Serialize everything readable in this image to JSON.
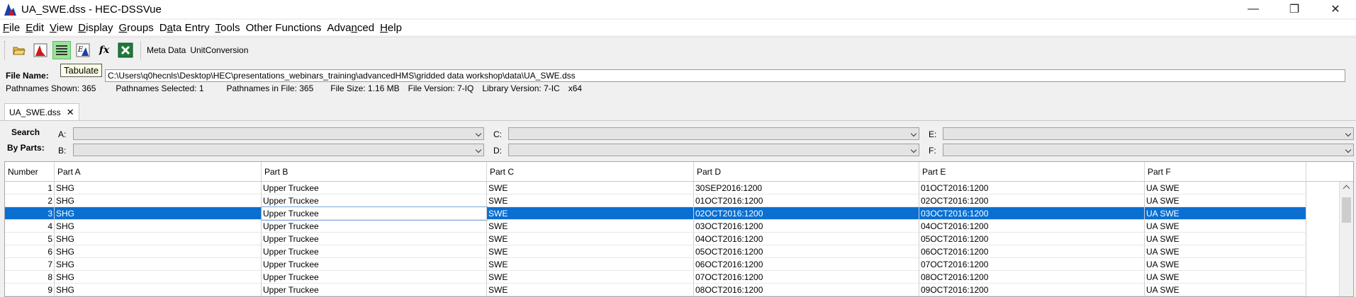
{
  "window": {
    "title": "UA_SWE.dss - HEC-DSSVue",
    "minimize": "—",
    "maximize": "❐",
    "close": "✕"
  },
  "menu": [
    {
      "pre": "",
      "u": "F",
      "post": "ile"
    },
    {
      "pre": "",
      "u": "E",
      "post": "dit"
    },
    {
      "pre": "",
      "u": "V",
      "post": "iew"
    },
    {
      "pre": "",
      "u": "D",
      "post": "isplay"
    },
    {
      "pre": "",
      "u": "G",
      "post": "roups"
    },
    {
      "pre": "D",
      "u": "a",
      "post": "ta Entry"
    },
    {
      "pre": "",
      "u": "T",
      "post": "ools"
    },
    {
      "pre": "Other Functions",
      "u": "",
      "post": ""
    },
    {
      "pre": "Adva",
      "u": "n",
      "post": "ced"
    },
    {
      "pre": "",
      "u": "H",
      "post": "elp"
    }
  ],
  "toolbar": {
    "metadata_label": "Meta Data",
    "unitconversion_label": "UnitConversion",
    "tooltip": "Tabulate",
    "fx_label": "fx"
  },
  "file": {
    "label": "File Name:",
    "path": "C:\\Users\\q0hecnls\\Desktop\\HEC\\presentations_webinars_training\\advancedHMS\\gridded data workshop\\data\\UA_SWE.dss"
  },
  "stats": {
    "shown": "Pathnames Shown:  365",
    "selected": "Pathnames Selected: 1",
    "in_file": "Pathnames in File:  365",
    "size": "File Size:  1.16  MB",
    "version": "File Version: 7-IQ",
    "library": "Library Version: 7-IC",
    "arch": "x64"
  },
  "tab": {
    "label": "UA_SWE.dss",
    "close": "✕"
  },
  "search": {
    "label1": "Search",
    "label2": "By Parts:",
    "parts": [
      "A:",
      "B:",
      "C:",
      "D:",
      "E:",
      "F:"
    ]
  },
  "table": {
    "headers": [
      "Number",
      "Part A",
      "Part B",
      "Part C",
      "Part D",
      "Part E",
      "Part F"
    ],
    "selected_row": 2,
    "rows": [
      [
        "1",
        "SHG",
        "Upper Truckee",
        "SWE",
        "30SEP2016:1200",
        "01OCT2016:1200",
        "UA SWE"
      ],
      [
        "2",
        "SHG",
        "Upper Truckee",
        "SWE",
        "01OCT2016:1200",
        "02OCT2016:1200",
        "UA SWE"
      ],
      [
        "3",
        "SHG",
        "Upper Truckee",
        "SWE",
        "02OCT2016:1200",
        "03OCT2016:1200",
        "UA SWE"
      ],
      [
        "4",
        "SHG",
        "Upper Truckee",
        "SWE",
        "03OCT2016:1200",
        "04OCT2016:1200",
        "UA SWE"
      ],
      [
        "5",
        "SHG",
        "Upper Truckee",
        "SWE",
        "04OCT2016:1200",
        "05OCT2016:1200",
        "UA SWE"
      ],
      [
        "6",
        "SHG",
        "Upper Truckee",
        "SWE",
        "05OCT2016:1200",
        "06OCT2016:1200",
        "UA SWE"
      ],
      [
        "7",
        "SHG",
        "Upper Truckee",
        "SWE",
        "06OCT2016:1200",
        "07OCT2016:1200",
        "UA SWE"
      ],
      [
        "8",
        "SHG",
        "Upper Truckee",
        "SWE",
        "07OCT2016:1200",
        "08OCT2016:1200",
        "UA SWE"
      ],
      [
        "9",
        "SHG",
        "Upper Truckee",
        "SWE",
        "08OCT2016:1200",
        "09OCT2016:1200",
        "UA SWE"
      ]
    ]
  }
}
